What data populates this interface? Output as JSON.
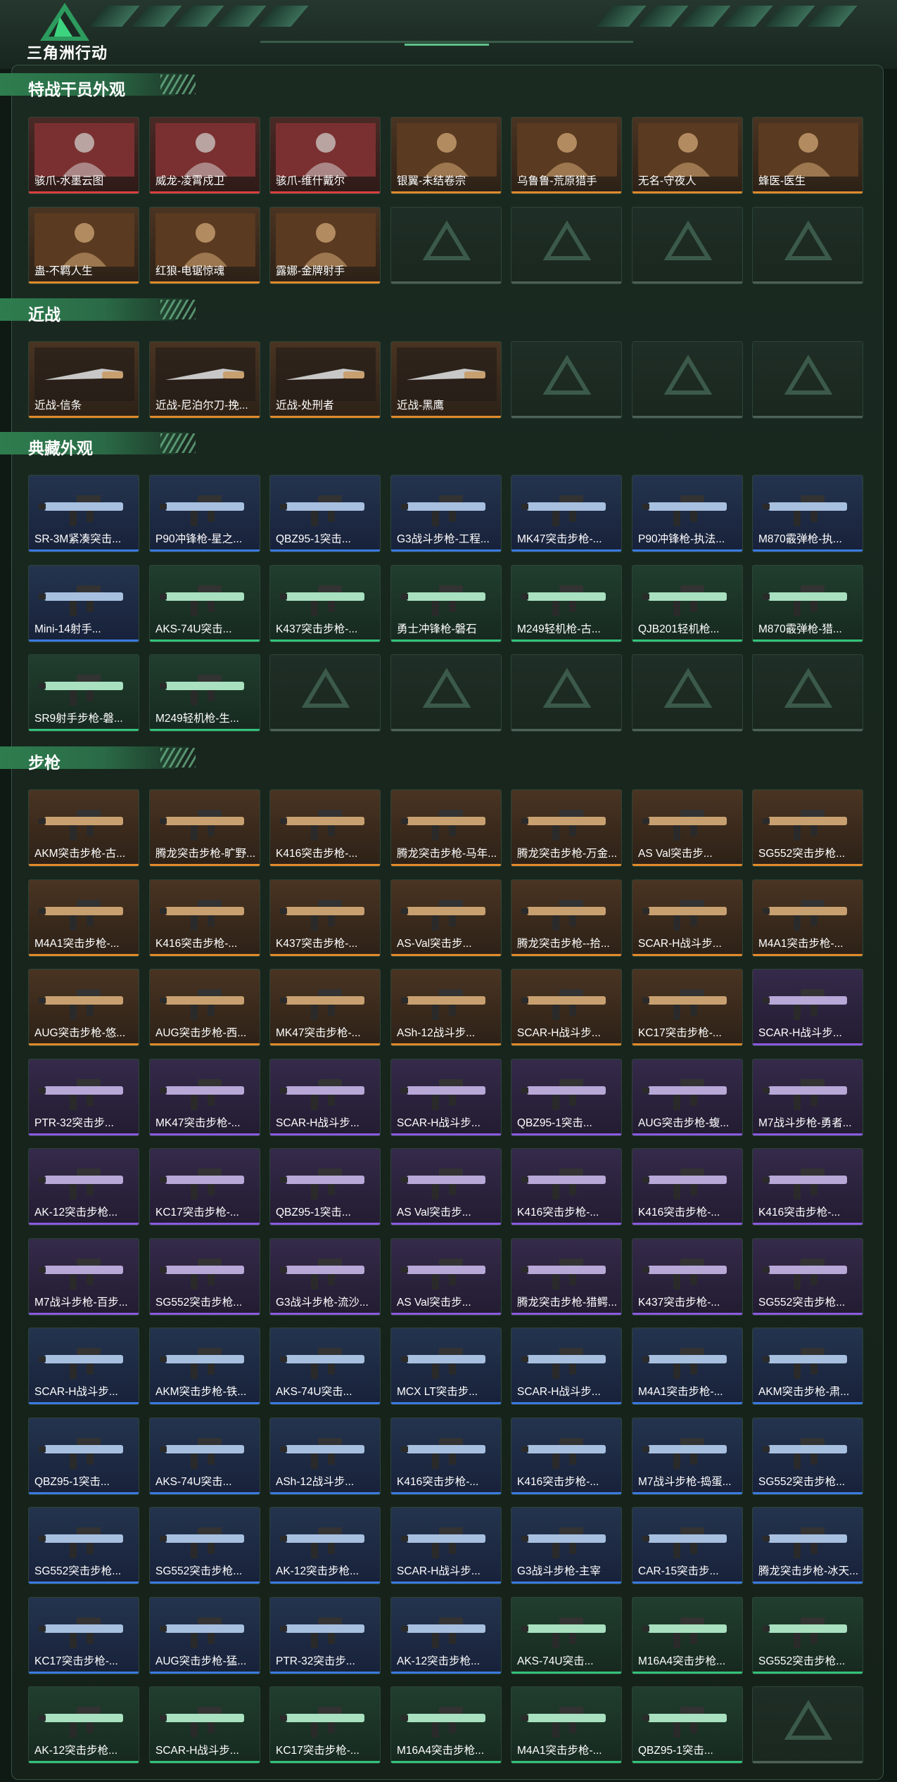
{
  "app": {
    "logo_text": "三角洲行动"
  },
  "sections": [
    {
      "title": "特战干员外观",
      "items": [
        {
          "label": "骇爪-水墨云图",
          "q": "red"
        },
        {
          "label": "威龙-凌霄戍卫",
          "q": "red"
        },
        {
          "label": "骇爪-维什戴尔",
          "q": "red"
        },
        {
          "label": "银翼-未结卷宗",
          "q": "orange"
        },
        {
          "label": "乌鲁鲁-荒原猎手",
          "q": "orange"
        },
        {
          "label": "无名-守夜人",
          "q": "orange"
        },
        {
          "label": "蜂医-医生",
          "q": "orange"
        },
        {
          "label": "蛊-不羁人生",
          "q": "orange"
        },
        {
          "label": "红狼-电锯惊魂",
          "q": "orange"
        },
        {
          "label": "露娜-金牌射手",
          "q": "orange"
        },
        {
          "label": "",
          "q": "empty"
        },
        {
          "label": "",
          "q": "empty"
        },
        {
          "label": "",
          "q": "empty"
        },
        {
          "label": "",
          "q": "empty"
        }
      ]
    },
    {
      "title": "近战",
      "items": [
        {
          "label": "近战-信条",
          "q": "orange"
        },
        {
          "label": "近战-尼泊尔刀-挽...",
          "q": "orange"
        },
        {
          "label": "近战-处刑者",
          "q": "orange"
        },
        {
          "label": "近战-黑鹰",
          "q": "orange"
        },
        {
          "label": "",
          "q": "empty"
        },
        {
          "label": "",
          "q": "empty"
        },
        {
          "label": "",
          "q": "empty"
        }
      ]
    },
    {
      "title": "典藏外观",
      "items": [
        {
          "label": "SR-3M紧凑突击...",
          "q": "blue"
        },
        {
          "label": "P90冲锋枪-星之...",
          "q": "blue"
        },
        {
          "label": "QBZ95-1突击...",
          "q": "blue"
        },
        {
          "label": "G3战斗步枪-工程...",
          "q": "blue"
        },
        {
          "label": "MK47突击步枪-...",
          "q": "blue"
        },
        {
          "label": "P90冲锋枪-执法...",
          "q": "blue"
        },
        {
          "label": "M870霰弹枪-执...",
          "q": "blue"
        },
        {
          "label": "Mini-14射手...",
          "q": "blue"
        },
        {
          "label": "AKS-74U突击...",
          "q": "green"
        },
        {
          "label": "K437突击步枪-...",
          "q": "green"
        },
        {
          "label": "勇士冲锋枪-磐石",
          "q": "green"
        },
        {
          "label": "M249轻机枪-古...",
          "q": "green"
        },
        {
          "label": "QJB201轻机枪...",
          "q": "green"
        },
        {
          "label": "M870霰弹枪-猎...",
          "q": "green"
        },
        {
          "label": "SR9射手步枪-磐...",
          "q": "green"
        },
        {
          "label": "M249轻机枪-生...",
          "q": "green"
        },
        {
          "label": "",
          "q": "empty"
        },
        {
          "label": "",
          "q": "empty"
        },
        {
          "label": "",
          "q": "empty"
        },
        {
          "label": "",
          "q": "empty"
        },
        {
          "label": "",
          "q": "empty"
        }
      ]
    },
    {
      "title": "步枪",
      "items": [
        {
          "label": "AKM突击步枪-古...",
          "q": "orange"
        },
        {
          "label": "腾龙突击步枪-旷野...",
          "q": "orange"
        },
        {
          "label": "K416突击步枪-...",
          "q": "orange"
        },
        {
          "label": "腾龙突击步枪-马年...",
          "q": "orange"
        },
        {
          "label": "腾龙突击步枪-万金...",
          "q": "orange"
        },
        {
          "label": "AS Val突击步...",
          "q": "orange"
        },
        {
          "label": "SG552突击步枪...",
          "q": "orange"
        },
        {
          "label": "M4A1突击步枪-...",
          "q": "orange"
        },
        {
          "label": "K416突击步枪-...",
          "q": "orange"
        },
        {
          "label": "K437突击步枪-...",
          "q": "orange"
        },
        {
          "label": "AS-Val突击步...",
          "q": "orange"
        },
        {
          "label": "腾龙突击步枪--拾...",
          "q": "orange"
        },
        {
          "label": "SCAR-H战斗步...",
          "q": "orange"
        },
        {
          "label": "M4A1突击步枪-...",
          "q": "orange"
        },
        {
          "label": "AUG突击步枪-悠...",
          "q": "orange"
        },
        {
          "label": "AUG突击步枪-西...",
          "q": "orange"
        },
        {
          "label": "MK47突击步枪-...",
          "q": "orange"
        },
        {
          "label": "ASh-12战斗步...",
          "q": "orange"
        },
        {
          "label": "SCAR-H战斗步...",
          "q": "orange"
        },
        {
          "label": "KC17突击步枪-...",
          "q": "orange"
        },
        {
          "label": "SCAR-H战斗步...",
          "q": "purple"
        },
        {
          "label": "PTR-32突击步...",
          "q": "purple"
        },
        {
          "label": "MK47突击步枪-...",
          "q": "purple"
        },
        {
          "label": "SCAR-H战斗步...",
          "q": "purple"
        },
        {
          "label": "SCAR-H战斗步...",
          "q": "purple"
        },
        {
          "label": "QBZ95-1突击...",
          "q": "purple"
        },
        {
          "label": "AUG突击步枪-蝮...",
          "q": "purple"
        },
        {
          "label": "M7战斗步枪-勇者...",
          "q": "purple"
        },
        {
          "label": "AK-12突击步枪...",
          "q": "purple"
        },
        {
          "label": "KC17突击步枪-...",
          "q": "purple"
        },
        {
          "label": "QBZ95-1突击...",
          "q": "purple"
        },
        {
          "label": "AS Val突击步...",
          "q": "purple"
        },
        {
          "label": "K416突击步枪-...",
          "q": "purple"
        },
        {
          "label": "K416突击步枪-...",
          "q": "purple"
        },
        {
          "label": "K416突击步枪-...",
          "q": "purple"
        },
        {
          "label": "M7战斗步枪-百步...",
          "q": "purple"
        },
        {
          "label": "SG552突击步枪...",
          "q": "purple"
        },
        {
          "label": "G3战斗步枪-流沙...",
          "q": "purple"
        },
        {
          "label": "AS Val突击步...",
          "q": "purple"
        },
        {
          "label": "腾龙突击步枪-猎鳄...",
          "q": "purple"
        },
        {
          "label": "K437突击步枪-...",
          "q": "purple"
        },
        {
          "label": "SG552突击步枪...",
          "q": "purple"
        },
        {
          "label": "SCAR-H战斗步...",
          "q": "blue"
        },
        {
          "label": "AKM突击步枪-铁...",
          "q": "blue"
        },
        {
          "label": "AKS-74U突击...",
          "q": "blue"
        },
        {
          "label": "MCX LT突击步...",
          "q": "blue"
        },
        {
          "label": "SCAR-H战斗步...",
          "q": "blue"
        },
        {
          "label": "M4A1突击步枪-...",
          "q": "blue"
        },
        {
          "label": "AKM突击步枪-肃...",
          "q": "blue"
        },
        {
          "label": "QBZ95-1突击...",
          "q": "blue"
        },
        {
          "label": "AKS-74U突击...",
          "q": "blue"
        },
        {
          "label": "ASh-12战斗步...",
          "q": "blue"
        },
        {
          "label": "K416突击步枪-...",
          "q": "blue"
        },
        {
          "label": "K416突击步枪-...",
          "q": "blue"
        },
        {
          "label": "M7战斗步枪-捣蛋...",
          "q": "blue"
        },
        {
          "label": "SG552突击步枪...",
          "q": "blue"
        },
        {
          "label": "SG552突击步枪...",
          "q": "blue"
        },
        {
          "label": "SG552突击步枪...",
          "q": "blue"
        },
        {
          "label": "AK-12突击步枪...",
          "q": "blue"
        },
        {
          "label": "SCAR-H战斗步...",
          "q": "blue"
        },
        {
          "label": "G3战斗步枪-主宰",
          "q": "blue"
        },
        {
          "label": "CAR-15突击步...",
          "q": "blue"
        },
        {
          "label": "腾龙突击步枪-冰天...",
          "q": "blue"
        },
        {
          "label": "KC17突击步枪-...",
          "q": "blue"
        },
        {
          "label": "AUG突击步枪-猛...",
          "q": "blue"
        },
        {
          "label": "PTR-32突击步...",
          "q": "blue"
        },
        {
          "label": "AK-12突击步枪...",
          "q": "blue"
        },
        {
          "label": "AKS-74U突击...",
          "q": "green"
        },
        {
          "label": "M16A4突击步枪...",
          "q": "green"
        },
        {
          "label": "SG552突击步枪...",
          "q": "green"
        },
        {
          "label": "AK-12突击步枪...",
          "q": "green"
        },
        {
          "label": "SCAR-H战斗步...",
          "q": "green"
        },
        {
          "label": "KC17突击步枪-...",
          "q": "green"
        },
        {
          "label": "M16A4突击步枪...",
          "q": "green"
        },
        {
          "label": "M4A1突击步枪-...",
          "q": "green"
        },
        {
          "label": "QBZ95-1突击...",
          "q": "green"
        },
        {
          "label": "",
          "q": "empty"
        }
      ]
    }
  ],
  "colors": {
    "accent": "#2e7d4e",
    "red": "#d94040",
    "orange": "#e08a2a",
    "purple": "#8a5ae0",
    "blue": "#3a7ae0",
    "green": "#33c27a"
  }
}
